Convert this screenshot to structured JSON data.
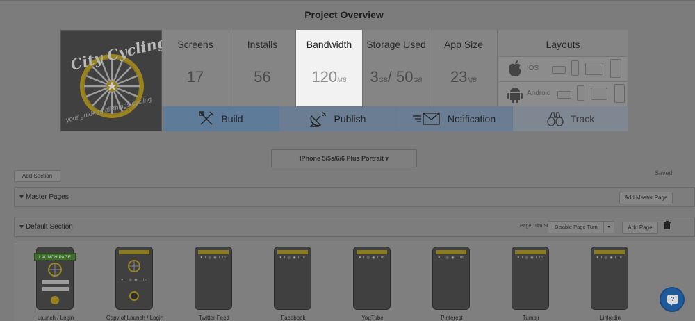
{
  "page": {
    "title": "Project Overview"
  },
  "logo": {
    "line1": "City Cycling",
    "tagline": "your guide to all things cycling"
  },
  "stats": {
    "screens": {
      "label": "Screens",
      "value": "17"
    },
    "installs": {
      "label": "Installs",
      "value": "56"
    },
    "bandwidth": {
      "label": "Bandwidth",
      "value": "120",
      "unit": "MB"
    },
    "storage": {
      "label": "Storage Used",
      "value": "3",
      "unit1": "GB",
      "sep": "/ 50",
      "unit2": "GB"
    },
    "app_size": {
      "label": "App Size",
      "value": "23",
      "unit": "MB"
    }
  },
  "layouts": {
    "label": "Layouts",
    "ios": "IOS",
    "android": "Android"
  },
  "actions": {
    "build": "Build",
    "publish": "Publish",
    "notification": "Notification",
    "track": "Track"
  },
  "toolbar": {
    "device": "IPhone 5/5s/6/6 Plus Portrait ▾",
    "add_section": "Add Section",
    "saved": "Saved"
  },
  "master": {
    "title": "Master Pages",
    "add_button": "Add Master Page"
  },
  "default_section": {
    "title": "Default Section",
    "page_turn_label": "Page Turn Style:",
    "page_turn_value": "Disable Page Turn",
    "page_turn_arrow": "▾",
    "add_page": "Add Page"
  },
  "screens": [
    {
      "label": "Launch / Login",
      "ribbon": "LAUNCH PAGE"
    },
    {
      "label": "Copy of Launch / Login"
    },
    {
      "label": "Twitter Feed"
    },
    {
      "label": "Facebook"
    },
    {
      "label": "YouTube"
    },
    {
      "label": "Pinterest"
    },
    {
      "label": "Tumblr"
    },
    {
      "label": "Linkedin"
    }
  ],
  "screen_social": "♥ f ◎ ◉ t in",
  "help": {
    "glyph": "?"
  },
  "colors": {
    "accent_blue": "#5e7b99",
    "highlight": "#f2f2f2",
    "gold": "#c9a227",
    "help": "#1f5a9a"
  }
}
